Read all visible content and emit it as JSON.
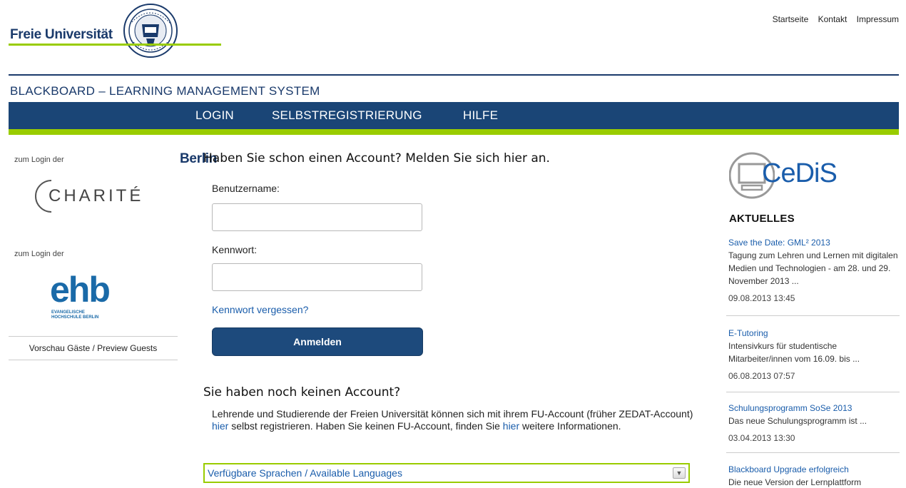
{
  "header": {
    "logo_left": "Freie Universität",
    "logo_right": "Berlin",
    "topnav": [
      "Startseite",
      "Kontakt",
      "Impressum"
    ]
  },
  "system_title": "BLACKBOARD – LEARNING MANAGEMENT SYSTEM",
  "mainnav": [
    "LOGIN",
    "SELBSTREGISTRIERUNG",
    "HILFE"
  ],
  "left": {
    "charite_label": "zum Login der",
    "charite_logo": "CHARITÉ",
    "ehb_label": "zum Login der",
    "ehb_logo": "ehb",
    "ehb_sub1": "EVANGELISCHE",
    "ehb_sub2": "HOCHSCHULE BERLIN",
    "preview": "Vorschau Gäste / Preview Guests"
  },
  "login": {
    "heading": "Haben Sie schon einen Account? Melden Sie sich hier an.",
    "username_label": "Benutzername:",
    "username_value": "",
    "password_label": "Kennwort:",
    "password_value": "",
    "forgot": "Kennwort vergessen?",
    "submit": "Anmelden"
  },
  "register": {
    "heading": "Sie haben noch keinen Account?",
    "text1": "Lehrende und Studierende der Freien Universität können sich mit ihrem FU-Account (früher ZEDAT-Account) ",
    "link1": "hier",
    "text2": " selbst registrieren. Haben Sie keinen FU-Account, finden Sie ",
    "link2": "hier",
    "text3": " weitere Informationen."
  },
  "languages": {
    "label": "Verfügbare Sprachen / Available Languages"
  },
  "right": {
    "cedis_logo": "CeDiS",
    "heading": "AKTUELLES",
    "news": [
      {
        "title": "Save the Date: GML² 2013",
        "text": "Tagung zum Lehren und Lernen mit digitalen Medien und Technologien - am 28. und 29. November 2013 ...",
        "date": "09.08.2013 13:45"
      },
      {
        "title": "E-Tutoring",
        "text": "Intensivkurs für studentische Mitarbeiter/innen vom 16.09. bis ...",
        "date": "06.08.2013 07:57"
      },
      {
        "title": "Schulungsprogramm SoSe 2013",
        "text": "Das neue Schulungsprogramm ist ...",
        "date": "03.04.2013 13:30"
      },
      {
        "title": "Blackboard Upgrade erfolgreich",
        "text": "Die neue Version der Lernplattform",
        "date": ""
      }
    ]
  }
}
